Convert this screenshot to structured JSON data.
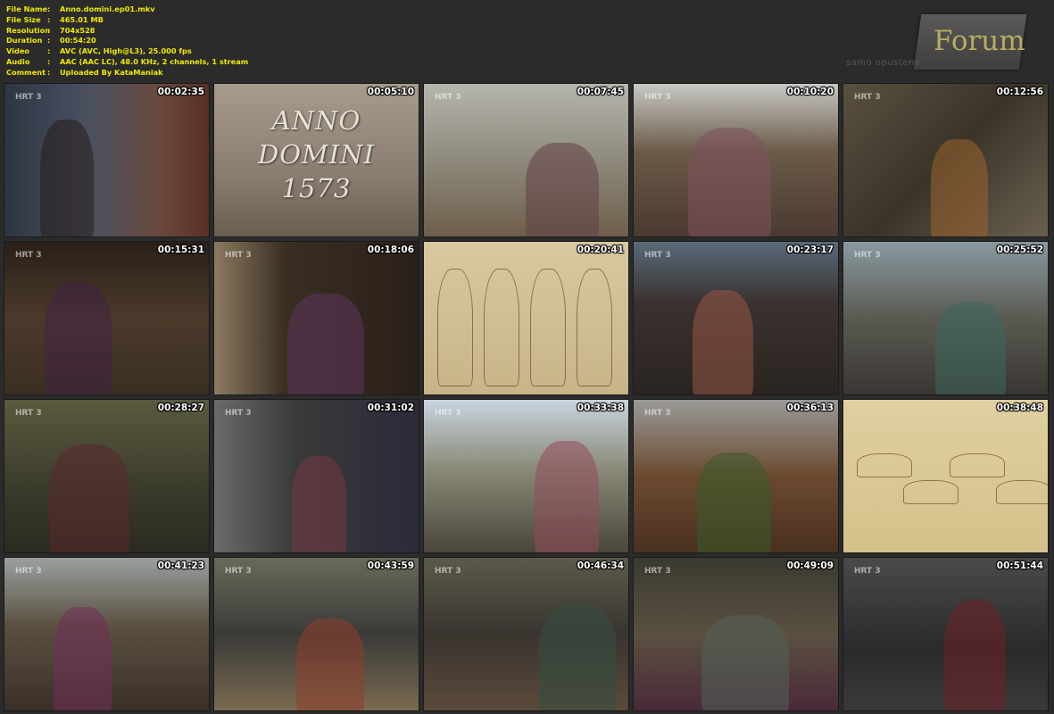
{
  "info": [
    {
      "key": "File Name",
      "value": "Anno.domini.ep01.mkv"
    },
    {
      "key": "File Size",
      "value": "465.01 MB"
    },
    {
      "key": "Resolution",
      "value": "704x528"
    },
    {
      "key": "Duration",
      "value": "00:54:20"
    },
    {
      "key": "Video",
      "value": "AVC (AVC, High@L3), 25.000 fps"
    },
    {
      "key": "Audio",
      "value": "AAC (AAC LC), 48.0 KHz, 2 channels, 1 stream"
    },
    {
      "key": "Comment",
      "value": "Uploaded By KataManiak"
    }
  ],
  "logo": {
    "word": "Forum",
    "tagline": "samo opusteno"
  },
  "channel_bug": "HRT 3",
  "title_card": [
    "ANNO",
    "DOMINI",
    "1573"
  ],
  "thumbnails": [
    {
      "time": "00:02:35",
      "bg": "linear-gradient(90deg,#2d3542 0%,#4a5060 40%,#6a4a3e 75%,#5a2e25 100%)"
    },
    {
      "time": "00:05:10",
      "bg": "linear-gradient(180deg,#a89b8c 0%,#8a7d70 60%,#6a5e50 100%)"
    },
    {
      "time": "00:07:45",
      "bg": "linear-gradient(180deg,#b6b6ae 0%,#8e8a7c 50%,#6e5e4a 100%)"
    },
    {
      "time": "00:10:20",
      "bg": "linear-gradient(180deg,#c8c8c4 0%,#6a5a48 45%,#4a3a30 100%)"
    },
    {
      "time": "00:12:56",
      "bg": "linear-gradient(135deg,#5a5040 0%,#3a3428 50%,#6a6050 100%)"
    },
    {
      "time": "00:15:31",
      "bg": "linear-gradient(180deg,#2a2018 0%,#4a3a2a 50%,#3a2e22 100%)"
    },
    {
      "time": "00:18:06",
      "bg": "linear-gradient(90deg,#8a7a60 0%,#3a2e22 35%,#2a201a 100%)"
    },
    {
      "time": "00:20:41",
      "bg": "linear-gradient(180deg,#d8c8a0 0%,#c8b488 100%)"
    },
    {
      "time": "00:23:17",
      "bg": "linear-gradient(180deg,#5a6a7a 0%,#3a3230 40%,#2a2420 100%)"
    },
    {
      "time": "00:25:52",
      "bg": "linear-gradient(180deg,#8a9aa0 0%,#5a5a52 50%,#3a3632 100%)"
    },
    {
      "time": "00:28:27",
      "bg": "linear-gradient(180deg,#5a5a40 0%,#3a3a2a 60%,#2a2a20 100%)"
    },
    {
      "time": "00:31:02",
      "bg": "linear-gradient(90deg,#6a6a6a 0%,#3a3a3a 40%,#2a2a3a 100%)"
    },
    {
      "time": "00:33:38",
      "bg": "linear-gradient(180deg,#c8d4e0 0%,#8a8a78 45%,#4a4638 100%)"
    },
    {
      "time": "00:36:13",
      "bg": "linear-gradient(180deg,#9a9a98 0%,#6a4a30 50%,#4a3020 100%)"
    },
    {
      "time": "00:38:48",
      "bg": "linear-gradient(180deg,#e0d0a0 0%,#d4c08a 100%)"
    },
    {
      "time": "00:41:23",
      "bg": "linear-gradient(180deg,#9aa0a0 0%,#5a5040 45%,#3a3028 100%)"
    },
    {
      "time": "00:43:59",
      "bg": "linear-gradient(180deg,#6a6a5a 0%,#3a3a38 50%,#7a6a50 100%)"
    },
    {
      "time": "00:46:34",
      "bg": "linear-gradient(180deg,#5a5a4a 0%,#3a3430 50%,#5a4a3a 100%)"
    },
    {
      "time": "00:49:09",
      "bg": "linear-gradient(180deg,#3a3a30 0%,#5a5040 50%,#4a2a3a 100%)"
    },
    {
      "time": "00:51:44",
      "bg": "linear-gradient(180deg,#4a4a4a 0%,#2a2a2a 60%,#3a3a3a 100%)"
    }
  ]
}
